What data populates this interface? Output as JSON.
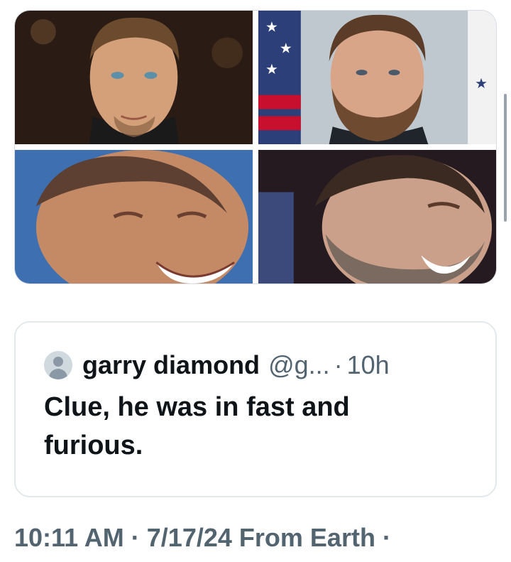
{
  "media": {
    "images": [
      {
        "description_icon": "portrait-photo"
      },
      {
        "description_icon": "portrait-photo"
      },
      {
        "description_icon": "laughing-photo"
      },
      {
        "description_icon": "laughing-photo"
      }
    ]
  },
  "quoted_tweet": {
    "author_name": "garry diamond",
    "author_handle": "@g...",
    "separator": "·",
    "time": "10h",
    "text": "Clue, he was in fast and furious."
  },
  "post_meta": {
    "time": "10:11 AM",
    "sep1": "·",
    "date": "7/17/24",
    "source": "From Earth",
    "sep2": "·"
  },
  "colors": {
    "text_primary": "#0f1419",
    "text_secondary": "#536471",
    "border": "#e3e8ec"
  }
}
